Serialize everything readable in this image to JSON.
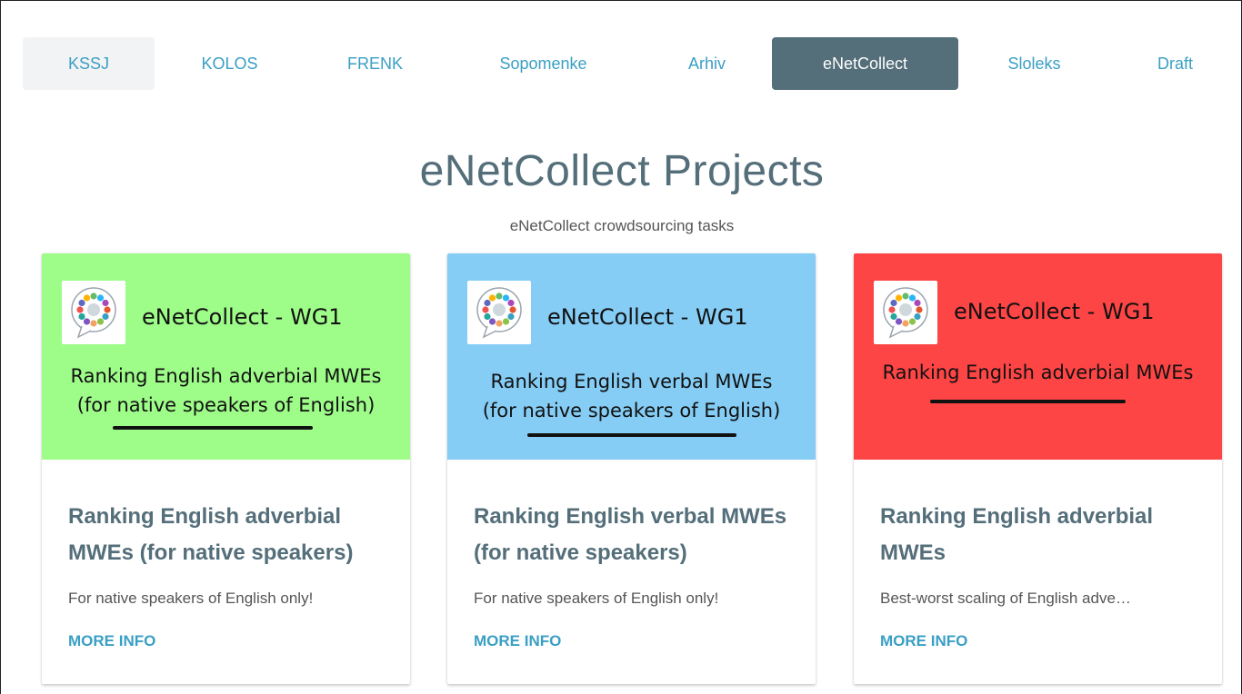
{
  "nav": {
    "tabs": [
      {
        "label": "KSSJ"
      },
      {
        "label": "KOLOS"
      },
      {
        "label": "FRENK"
      },
      {
        "label": "Sopomenke"
      },
      {
        "label": "Arhiv"
      },
      {
        "label": "eNetCollect"
      },
      {
        "label": "Sloleks"
      },
      {
        "label": "Draft"
      }
    ],
    "active_tab": "eNetCollect"
  },
  "header": {
    "title": "eNetCollect Projects",
    "subtitle": "eNetCollect crowdsourcing tasks"
  },
  "cards": [
    {
      "banner_color": "#9efc89",
      "banner_wg": "eNetCollect - WG1",
      "banner_line1": "Ranking English adverbial MWEs",
      "banner_line2": "(for native speakers of English)",
      "title": "Ranking English adverbial MWEs (for native speakers)",
      "description": "For native speakers of English only!",
      "link_label": "MORE INFO"
    },
    {
      "banner_color": "#85cdf5",
      "banner_wg": "eNetCollect - WG1",
      "banner_line1": "Ranking English verbal MWEs",
      "banner_line2": "(for native speakers of English)",
      "title": "Ranking English verbal MWEs (for native speakers)",
      "description": "For native speakers of English only!",
      "link_label": "MORE INFO"
    },
    {
      "banner_color": "#fe4545",
      "banner_wg": "eNetCollect - WG1",
      "banner_line1": "Ranking English adverbial MWEs",
      "title": "Ranking English adverbial MWEs",
      "description": "Best-worst scaling of English adve…",
      "link_label": "MORE INFO"
    }
  ],
  "colors": {
    "accent": "#3a9fc4",
    "active_tab_bg": "#546e7a",
    "heading": "#546e7a"
  },
  "icons": {
    "banner_logo": "enetcollect-logo-icon"
  }
}
